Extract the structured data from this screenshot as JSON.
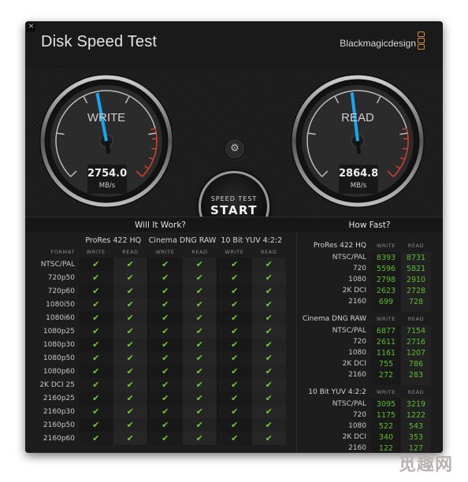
{
  "window": {
    "title": "Disk Speed Test",
    "brand": "Blackmagicdesign",
    "close_icon": "close-icon"
  },
  "gauges": {
    "write": {
      "label": "WRITE",
      "value": "2754.0",
      "unit": "MB/s",
      "needle_fraction": 0.46
    },
    "read": {
      "label": "READ",
      "value": "2864.8",
      "unit": "MB/s",
      "needle_fraction": 0.475
    }
  },
  "controls": {
    "settings_icon": "gear-icon",
    "start_sub": "SPEED TEST",
    "start_main": "START"
  },
  "will_it_work": {
    "title": "Will It Work?",
    "format_label": "FORMAT",
    "codecs": [
      "ProRes 422 HQ",
      "Cinema DNG RAW",
      "10 Bit YUV 4:2:2"
    ],
    "columns": [
      "WRITE",
      "READ"
    ],
    "check_glyph": "✔",
    "formats": [
      "NTSC/PAL",
      "720p50",
      "720p60",
      "1080i50",
      "1080i60",
      "1080p25",
      "1080p30",
      "1080p50",
      "1080p60",
      "2K DCI 25",
      "2160p25",
      "2160p30",
      "2160p50",
      "2160p60"
    ],
    "results": [
      [
        true,
        true,
        true,
        true,
        true,
        true
      ],
      [
        true,
        true,
        true,
        true,
        true,
        true
      ],
      [
        true,
        true,
        true,
        true,
        true,
        true
      ],
      [
        true,
        true,
        true,
        true,
        true,
        true
      ],
      [
        true,
        true,
        true,
        true,
        true,
        true
      ],
      [
        true,
        true,
        true,
        true,
        true,
        true
      ],
      [
        true,
        true,
        true,
        true,
        true,
        true
      ],
      [
        true,
        true,
        true,
        true,
        true,
        true
      ],
      [
        true,
        true,
        true,
        true,
        true,
        true
      ],
      [
        true,
        true,
        true,
        true,
        true,
        true
      ],
      [
        true,
        true,
        true,
        true,
        true,
        true
      ],
      [
        true,
        true,
        true,
        true,
        true,
        true
      ],
      [
        true,
        true,
        true,
        true,
        true,
        true
      ],
      [
        true,
        true,
        true,
        true,
        true,
        true
      ]
    ]
  },
  "how_fast": {
    "title": "How Fast?",
    "columns": [
      "WRITE",
      "READ"
    ],
    "groups": [
      {
        "name": "ProRes 422 HQ",
        "rows": [
          {
            "format": "NTSC/PAL",
            "write": "8393",
            "read": "8731"
          },
          {
            "format": "720",
            "write": "5596",
            "read": "5821"
          },
          {
            "format": "1080",
            "write": "2798",
            "read": "2910"
          },
          {
            "format": "2K DCI",
            "write": "2623",
            "read": "2728"
          },
          {
            "format": "2160",
            "write": "699",
            "read": "728"
          }
        ]
      },
      {
        "name": "Cinema DNG RAW",
        "rows": [
          {
            "format": "NTSC/PAL",
            "write": "6877",
            "read": "7154"
          },
          {
            "format": "720",
            "write": "2611",
            "read": "2716"
          },
          {
            "format": "1080",
            "write": "1161",
            "read": "1207"
          },
          {
            "format": "2K DCI",
            "write": "755",
            "read": "786"
          },
          {
            "format": "2160",
            "write": "272",
            "read": "283"
          }
        ]
      },
      {
        "name": "10 Bit YUV 4:2:2",
        "rows": [
          {
            "format": "NTSC/PAL",
            "write": "3095",
            "read": "3219"
          },
          {
            "format": "720",
            "write": "1175",
            "read": "1222"
          },
          {
            "format": "1080",
            "write": "522",
            "read": "543"
          },
          {
            "format": "2K DCI",
            "write": "340",
            "read": "353"
          },
          {
            "format": "2160",
            "write": "122",
            "read": "127"
          }
        ]
      }
    ]
  },
  "watermark": "觅趣网",
  "colors": {
    "needle": "#1aa6ee",
    "redline": "#d8402e",
    "check": "#6fd02a",
    "value": "#5cbf2a",
    "brand_accent": "#d58c27"
  }
}
